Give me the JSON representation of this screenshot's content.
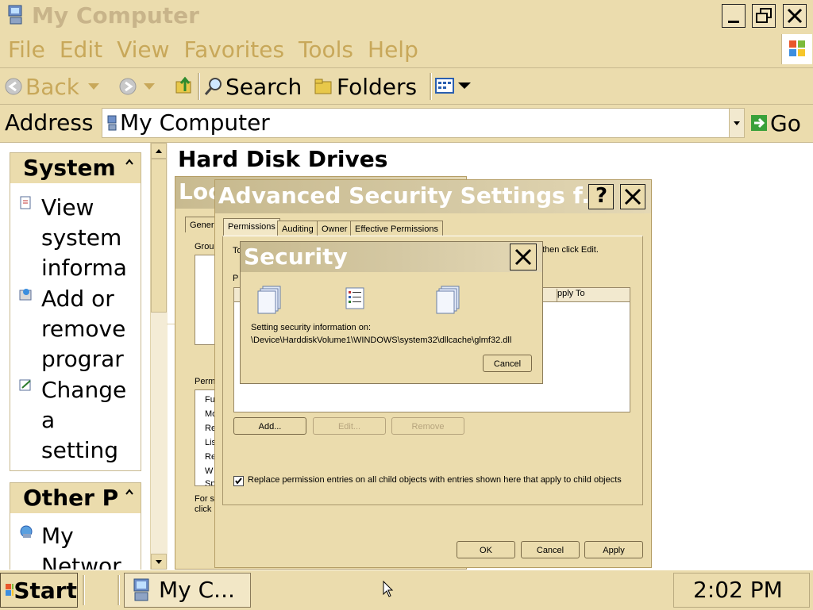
{
  "window": {
    "title": "My Computer"
  },
  "menu": [
    "File",
    "Edit",
    "View",
    "Favorites",
    "Tools",
    "Help"
  ],
  "toolbar": {
    "back": "Back",
    "search": "Search",
    "folders": "Folders"
  },
  "address": {
    "label": "Address",
    "value": "My Computer",
    "go": "Go"
  },
  "sidebar": {
    "system_header": "System",
    "system_items": [
      [
        "View",
        "system",
        "informa"
      ],
      [
        "Add or",
        "remove",
        "prograr"
      ],
      [
        "Change",
        "a",
        "setting"
      ]
    ],
    "other_header": "Other P",
    "other_items": [
      [
        "My",
        "Networ"
      ]
    ]
  },
  "main": {
    "section_title": "Hard Disk Drives"
  },
  "props_dialog": {
    "title_partial": "Loc",
    "tab_general": "Genera",
    "group_label": "Group",
    "perm_label": "Perm",
    "perm_items": [
      "Fu",
      "Mo",
      "Re",
      "Lis",
      "Re",
      "W",
      "Sp"
    ],
    "note": [
      "For sp",
      "click"
    ]
  },
  "advanced_dialog": {
    "title": "Advanced Security Settings f...",
    "tabs": [
      "Permissions",
      "Auditing",
      "Owner",
      "Effective Permissions"
    ],
    "intro_left": "To",
    "intro_right": "then click Edit.",
    "p_label": "P",
    "apply_to_header": "pply To",
    "buttons": {
      "add": "Add...",
      "edit": "Edit...",
      "remove": "Remove"
    },
    "checkbox_label": "Replace permission entries on all child objects with entries shown here that apply to child objects",
    "checkbox_checked": true,
    "footer": {
      "ok": "OK",
      "cancel": "Cancel",
      "apply": "Apply"
    }
  },
  "security_dialog": {
    "title": "Security",
    "message_line1": "Setting security information on:",
    "message_line2": "\\Device\\HarddiskVolume1\\WINDOWS\\system32\\dllcache\\glmf32.dll",
    "cancel": "Cancel"
  },
  "taskbar": {
    "start": "Start",
    "task": "My C...",
    "clock": "2:02 PM"
  },
  "colors": {
    "chrome": "#ebdcad",
    "menu_text": "#c8a85a",
    "panel_header": "#ebdcad"
  }
}
